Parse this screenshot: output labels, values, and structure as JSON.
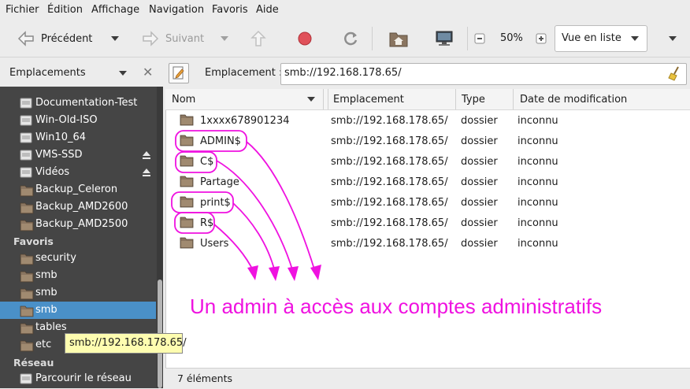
{
  "menu": [
    "Fichier",
    "Édition",
    "Affichage",
    "Navigation",
    "Favoris",
    "Aide"
  ],
  "toolbar": {
    "back_label": "Précédent",
    "forward_label": "Suivant",
    "zoom": "50%",
    "view_mode": "Vue en liste"
  },
  "sidebar": {
    "header": "Emplacements",
    "devices": [
      {
        "label": "Documentation-Test",
        "icon": "drive-icon",
        "eject": false
      },
      {
        "label": "Win-Old-ISO",
        "icon": "drive-icon",
        "eject": false
      },
      {
        "label": "Win10_64",
        "icon": "drive-icon",
        "eject": false
      },
      {
        "label": "VMS-SSD",
        "icon": "drive-icon",
        "eject": true
      },
      {
        "label": "Vidéos",
        "icon": "drive-icon",
        "eject": true
      },
      {
        "label": "Backup_Celeron",
        "icon": "folder-icon",
        "eject": false
      },
      {
        "label": "Backup_AMD2600",
        "icon": "folder-icon",
        "eject": false
      },
      {
        "label": "Backup_AMD2500",
        "icon": "folder-icon",
        "eject": false
      }
    ],
    "favorites_heading": "Favoris",
    "favorites": [
      {
        "label": "security",
        "selected": false
      },
      {
        "label": "smb",
        "selected": false
      },
      {
        "label": "smb",
        "selected": false
      },
      {
        "label": "smb",
        "selected": true
      },
      {
        "label": "tables",
        "selected": false
      },
      {
        "label": "etc",
        "selected": false
      }
    ],
    "network_heading": "Réseau",
    "network": [
      {
        "label": "Parcourir le réseau"
      }
    ]
  },
  "location": {
    "label": "Emplacement :",
    "value": "smb://192.168.178.65/"
  },
  "columns": {
    "name": "Nom",
    "location": "Emplacement",
    "type": "Type",
    "modified": "Date de modification"
  },
  "files": [
    {
      "name": "1xxxx678901234",
      "location": "smb://192.168.178.65/",
      "type": "dossier",
      "modified": "inconnu"
    },
    {
      "name": "ADMIN$",
      "location": "smb://192.168.178.65/",
      "type": "dossier",
      "modified": "inconnu"
    },
    {
      "name": "C$",
      "location": "smb://192.168.178.65/",
      "type": "dossier",
      "modified": "inconnu"
    },
    {
      "name": "Partage",
      "location": "smb://192.168.178.65/",
      "type": "dossier",
      "modified": "inconnu"
    },
    {
      "name": "print$",
      "location": "smb://192.168.178.65/",
      "type": "dossier",
      "modified": "inconnu"
    },
    {
      "name": "R$",
      "location": "smb://192.168.178.65/",
      "type": "dossier",
      "modified": "inconnu"
    },
    {
      "name": "Users",
      "location": "smb://192.168.178.65/",
      "type": "dossier",
      "modified": "inconnu"
    }
  ],
  "status": "7 éléments",
  "tooltip": "smb://192.168.178.65/",
  "annotation": "Un admin à accès aux comptes administratifs",
  "colors": {
    "annotation": "#ef12e0",
    "sidebar_bg": "#454545",
    "selection": "#4a90c8",
    "folder": "#8a7560"
  }
}
